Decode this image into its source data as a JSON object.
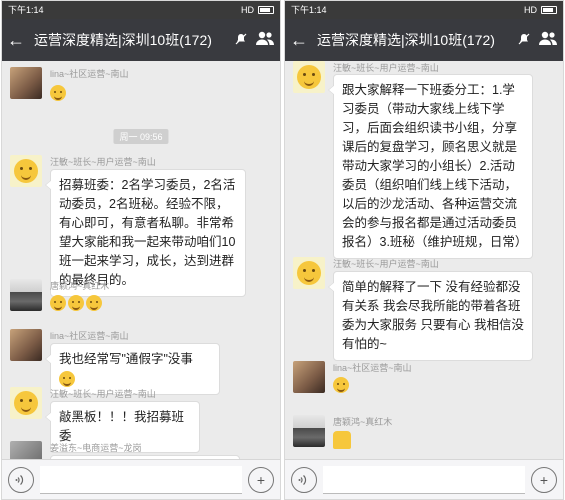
{
  "left": {
    "status": {
      "time": "下午1:14",
      "network": "HD"
    },
    "title": "运营深度精选|深圳10班(172)",
    "time_chip": "周一 09:56",
    "messages": [
      {
        "sender": "lina~社区运营~南山"
      },
      {
        "sender": "汪敏~班长~用户运营~南山",
        "text": "招募班委：2名学习委员，2名活动委员，2名班秘。经验不限，有心即可，有意者私聊。非常希望大家能和我一起来带动咱们10班一起来学习，成长，达到进群的最终目的。"
      },
      {
        "sender": "唐颖鸿~真红木"
      },
      {
        "sender": "lina~社区运营~南山",
        "text": "我也经常写\"通假字\"没事"
      },
      {
        "sender": "汪敏~班长~用户运营~南山",
        "text": "敲黑板！！！我招募班委"
      },
      {
        "sender": "姜溢东~电商运营~龙岗"
      }
    ]
  },
  "right": {
    "status": {
      "time": "下午1:14",
      "network": "HD"
    },
    "title": "运营深度精选|深圳10班(172)",
    "messages": [
      {
        "sender": "汪敏~班长~用户运营~南山",
        "text": "跟大家解释一下班委分工：1.学习委员（带动大家线上线下学习，后面会组织读书小组，分享课后的复盘学习，顾名思义就是带动大家学习的小组长）2.活动委员（组织咱们线上线下活动，以后的沙龙活动、各种运营交流会的参与报名都是通过活动委员报名）3.班秘（维护班规，日常）"
      },
      {
        "sender": "汪敏~班长~用户运营~南山",
        "text": "简单的解释了一下 没有经验都没有关系 我会尽我所能的带着各班委为大家服务 只要有心 我相信没有怕的~"
      },
      {
        "sender": "lina~社区运营~南山"
      },
      {
        "sender": "唐颖鸿~真红木"
      }
    ]
  }
}
